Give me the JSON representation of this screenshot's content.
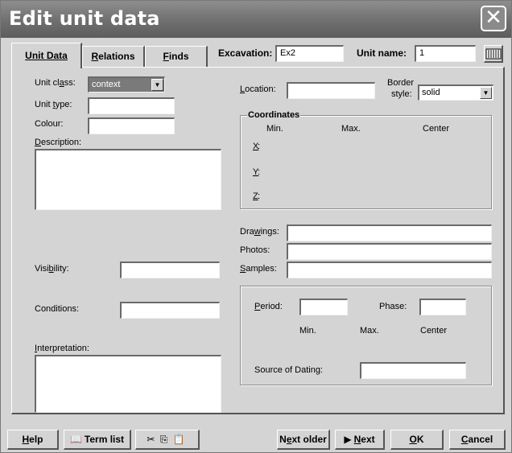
{
  "window": {
    "title": "Edit unit data",
    "close": "✕"
  },
  "tabs": [
    {
      "label": "Unit Data",
      "underline": "U",
      "rest": "nit Data",
      "active": true
    },
    {
      "label": "Relations",
      "underline": "R",
      "rest": "elations"
    },
    {
      "label": "Finds",
      "underline": "F",
      "rest": "inds"
    }
  ],
  "header": {
    "excavation_label": "Excavation:",
    "excavation_value": "Ex2",
    "unit_name_label": "Unit name:",
    "unit_name_value": "1",
    "keyboard_icon": "keyboard-icon"
  },
  "unit_data": {
    "unit_class_pre": "Unit cl",
    "unit_class_u": "a",
    "unit_class_post": "ss:",
    "unit_class_value": "context",
    "unit_type_pre": "Unit ",
    "unit_type_u": "t",
    "unit_type_post": "ype:",
    "colour_label": "Colour:",
    "description_u": "D",
    "description_post": "escription:",
    "visibility_pre": "Visi",
    "visibility_u": "b",
    "visibility_post": "ility:",
    "conditions_label": "Conditions:",
    "interpretation_u": "I",
    "interpretation_post": "nterpretation:",
    "location_u": "L",
    "location_post": "ocation:",
    "border_style_label_1": "Border",
    "border_style_label_2": "style:",
    "border_style_value": "solid",
    "coordinates": {
      "title": "Coordinates",
      "min": "Min.",
      "max": "Max.",
      "center": "Center",
      "x": "X",
      "y": "Y",
      "z": "Z"
    },
    "drawings_pre": "Dra",
    "drawings_u": "w",
    "drawings_post": "ings:",
    "photos_label": "Photos:",
    "samples_u": "S",
    "samples_post": "amples:",
    "dating": {
      "period_u": "P",
      "period_post": "eriod:",
      "phase_label": "Phase:",
      "min": "Min.",
      "max": "Max.",
      "center": "Center",
      "source_label": "Source of Dating:"
    }
  },
  "footer": {
    "help_u": "H",
    "help_post": "elp",
    "term_list": "Term list",
    "next_older_pre": "N",
    "next_older_u": "e",
    "next_older_post": "xt older",
    "next_label": "Next",
    "next_u": "N",
    "next_post": "ext",
    "ok_u": "O",
    "ok_post": "K",
    "cancel_u": "C",
    "cancel_post": "ancel"
  }
}
